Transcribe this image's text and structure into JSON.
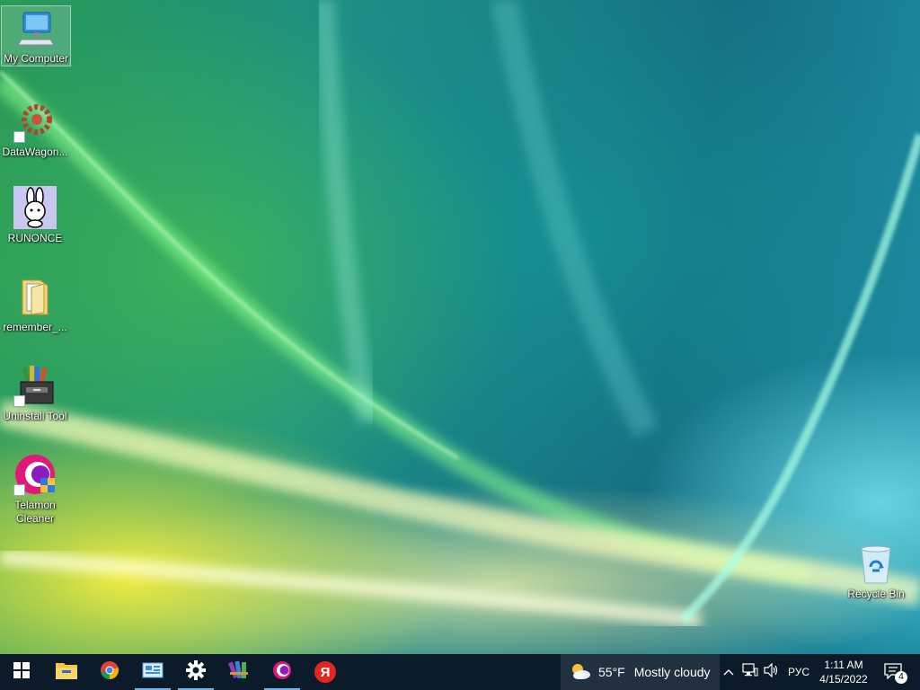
{
  "desktop": {
    "icons": [
      {
        "label": "My Computer",
        "icon": "computer-icon",
        "shortcut": false
      },
      {
        "label": "DataWagon...",
        "icon": "datawagon-icon",
        "shortcut": true
      },
      {
        "label": "RUNONCE",
        "icon": "bunny-icon",
        "shortcut": false
      },
      {
        "label": "remember_...",
        "icon": "folder-icon",
        "shortcut": false
      },
      {
        "label": "Uninstall Tool",
        "icon": "uninstall-tool-icon",
        "shortcut": true
      },
      {
        "label": "Telamon\nCleaner",
        "icon": "telamon-cleaner-icon",
        "shortcut": true
      },
      {
        "label": "Recycle Bin",
        "icon": "recycle-bin-icon",
        "shortcut": false
      }
    ]
  },
  "taskbar": {
    "apps": [
      {
        "name": "Start",
        "icon": "windows-start-icon"
      },
      {
        "name": "File Explorer",
        "icon": "file-explorer-icon"
      },
      {
        "name": "Google Chrome",
        "icon": "chrome-icon"
      },
      {
        "name": "Control Panel",
        "icon": "control-panel-icon"
      },
      {
        "name": "Settings",
        "icon": "gear-icon"
      },
      {
        "name": "WinRAR",
        "icon": "winrar-icon"
      },
      {
        "name": "Telamon Cleaner",
        "icon": "telamon-cleaner-icon"
      },
      {
        "name": "Yandex Browser",
        "icon": "yandex-icon",
        "glyph": "Я"
      }
    ],
    "weather": {
      "temperature": "55°F",
      "condition": "Mostly cloudy",
      "icon": "partly-cloudy-icon"
    },
    "tray": {
      "language": "РУС",
      "time": "1:11 AM",
      "date": "4/15/2022",
      "notification_count": "4"
    }
  },
  "colors": {
    "taskbar": "#0b1b2a",
    "running_indicator": "#6fb3e6",
    "yandex_red": "#e52620",
    "windows_blue": "#ffffff"
  }
}
